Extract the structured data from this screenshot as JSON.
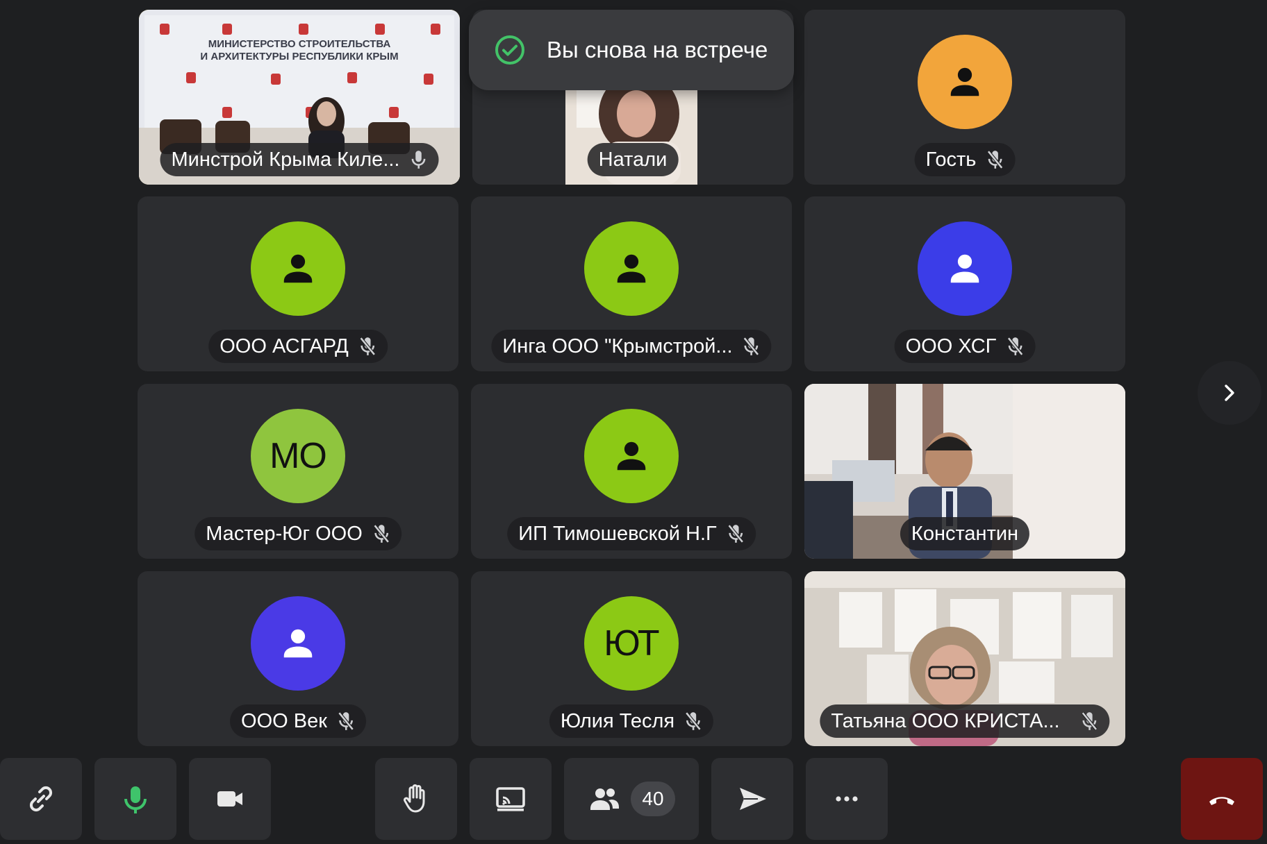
{
  "toast": {
    "message": "Вы снова на встрече",
    "icon": "check-circle-icon"
  },
  "participants": [
    {
      "name": "Минстрой Крыма Киле...",
      "type": "video",
      "mic": "on",
      "active": true,
      "backdrop_text": "МИНИСТЕРСТВО СТРОИТЕЛЬСТВА И АРХИТЕКТУРЫ РЕСПУБЛИКИ КРЫМ"
    },
    {
      "name": "Натали",
      "type": "video",
      "mic": "none"
    },
    {
      "name": "Гость",
      "type": "avatar",
      "avatar_color": "#f2a53b",
      "mic": "off"
    },
    {
      "name": "ООО АСГАРД",
      "type": "avatar",
      "avatar_color": "#8cc915",
      "mic": "off"
    },
    {
      "name": "Инга ООО \"Крымстрой...",
      "type": "avatar",
      "avatar_color": "#8cc915",
      "mic": "off"
    },
    {
      "name": "ООО ХСГ",
      "type": "avatar",
      "avatar_color": "#3b3de8",
      "mic": "off"
    },
    {
      "name": "Мастер-Юг ООО",
      "type": "initials",
      "initials": "МО",
      "avatar_color": "#8fc53e",
      "mic": "off"
    },
    {
      "name": "ИП Тимошевской Н.Г",
      "type": "avatar",
      "avatar_color": "#8cc915",
      "mic": "off"
    },
    {
      "name": "Константин",
      "type": "video",
      "mic": "none"
    },
    {
      "name": "ООО Век",
      "type": "avatar",
      "avatar_color": "#4a3ae6",
      "mic": "off"
    },
    {
      "name": "Юлия Тесля",
      "type": "initials",
      "initials": "ЮТ",
      "avatar_color": "#8cc915",
      "mic": "off"
    },
    {
      "name": "Татьяна ООО КРИСТА...",
      "type": "video",
      "mic": "off"
    }
  ],
  "toolbar": {
    "participants_count": "40",
    "mic_color": "#3fc46b",
    "end_call_color": "#6e1512",
    "buttons": [
      "link-icon",
      "microphone-icon",
      "camera-icon",
      "raise-hand-icon",
      "screen-share-icon",
      "participants-icon",
      "send-icon",
      "more-icon",
      "end-call-icon"
    ]
  },
  "colors": {
    "background": "#1e1f21",
    "tile": "#2c2d30",
    "active_border": "#f6cf3d"
  }
}
